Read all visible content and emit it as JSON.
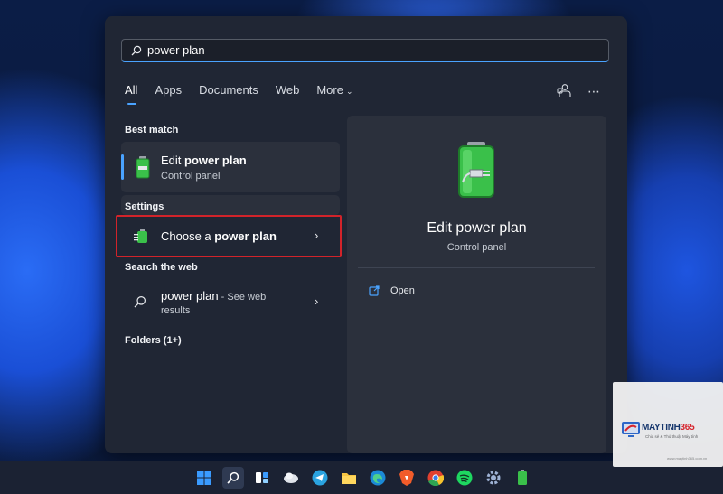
{
  "search": {
    "value": "power plan"
  },
  "tabs": [
    {
      "label": "All",
      "active": true
    },
    {
      "label": "Apps"
    },
    {
      "label": "Documents"
    },
    {
      "label": "Web"
    },
    {
      "label": "More",
      "chevron": "chevron-down-icon"
    }
  ],
  "toolbar_icons": [
    "accounts-icon",
    "more-options-icon"
  ],
  "best_match": {
    "heading": "Best match",
    "title_prefix": "Edit ",
    "title_bold": "power plan",
    "subtitle": "Control panel"
  },
  "settings": {
    "heading": "Settings",
    "item_prefix": "Choose a ",
    "item_bold": "power plan"
  },
  "web": {
    "heading": "Search the web",
    "query": "power plan",
    "suffix": " - See web",
    "suffix2": "results"
  },
  "folders": {
    "heading": "Folders (1+)"
  },
  "detail": {
    "title": "Edit power plan",
    "subtitle": "Control panel",
    "action_open": "Open"
  },
  "taskbar_apps": [
    "windows-start-icon",
    "search-icon",
    "widgets-icon",
    "onedrive-icon",
    "telegram-icon",
    "file-explorer-icon",
    "edge-icon",
    "brave-icon",
    "chrome-icon",
    "spotify-icon",
    "settings-gear-icon",
    "battery-icon"
  ],
  "watermark": {
    "brand_main": "MAYTINH",
    "brand_accent": "365",
    "tagline": "Chia sẻ & Thủ thuật Máy tính",
    "url": "www.maytinh365.com.vn"
  },
  "colors": {
    "accent": "#4aa3ff",
    "highlight_border": "#d2232a",
    "panel_bg": "#202634",
    "card_bg": "#2b303c"
  }
}
